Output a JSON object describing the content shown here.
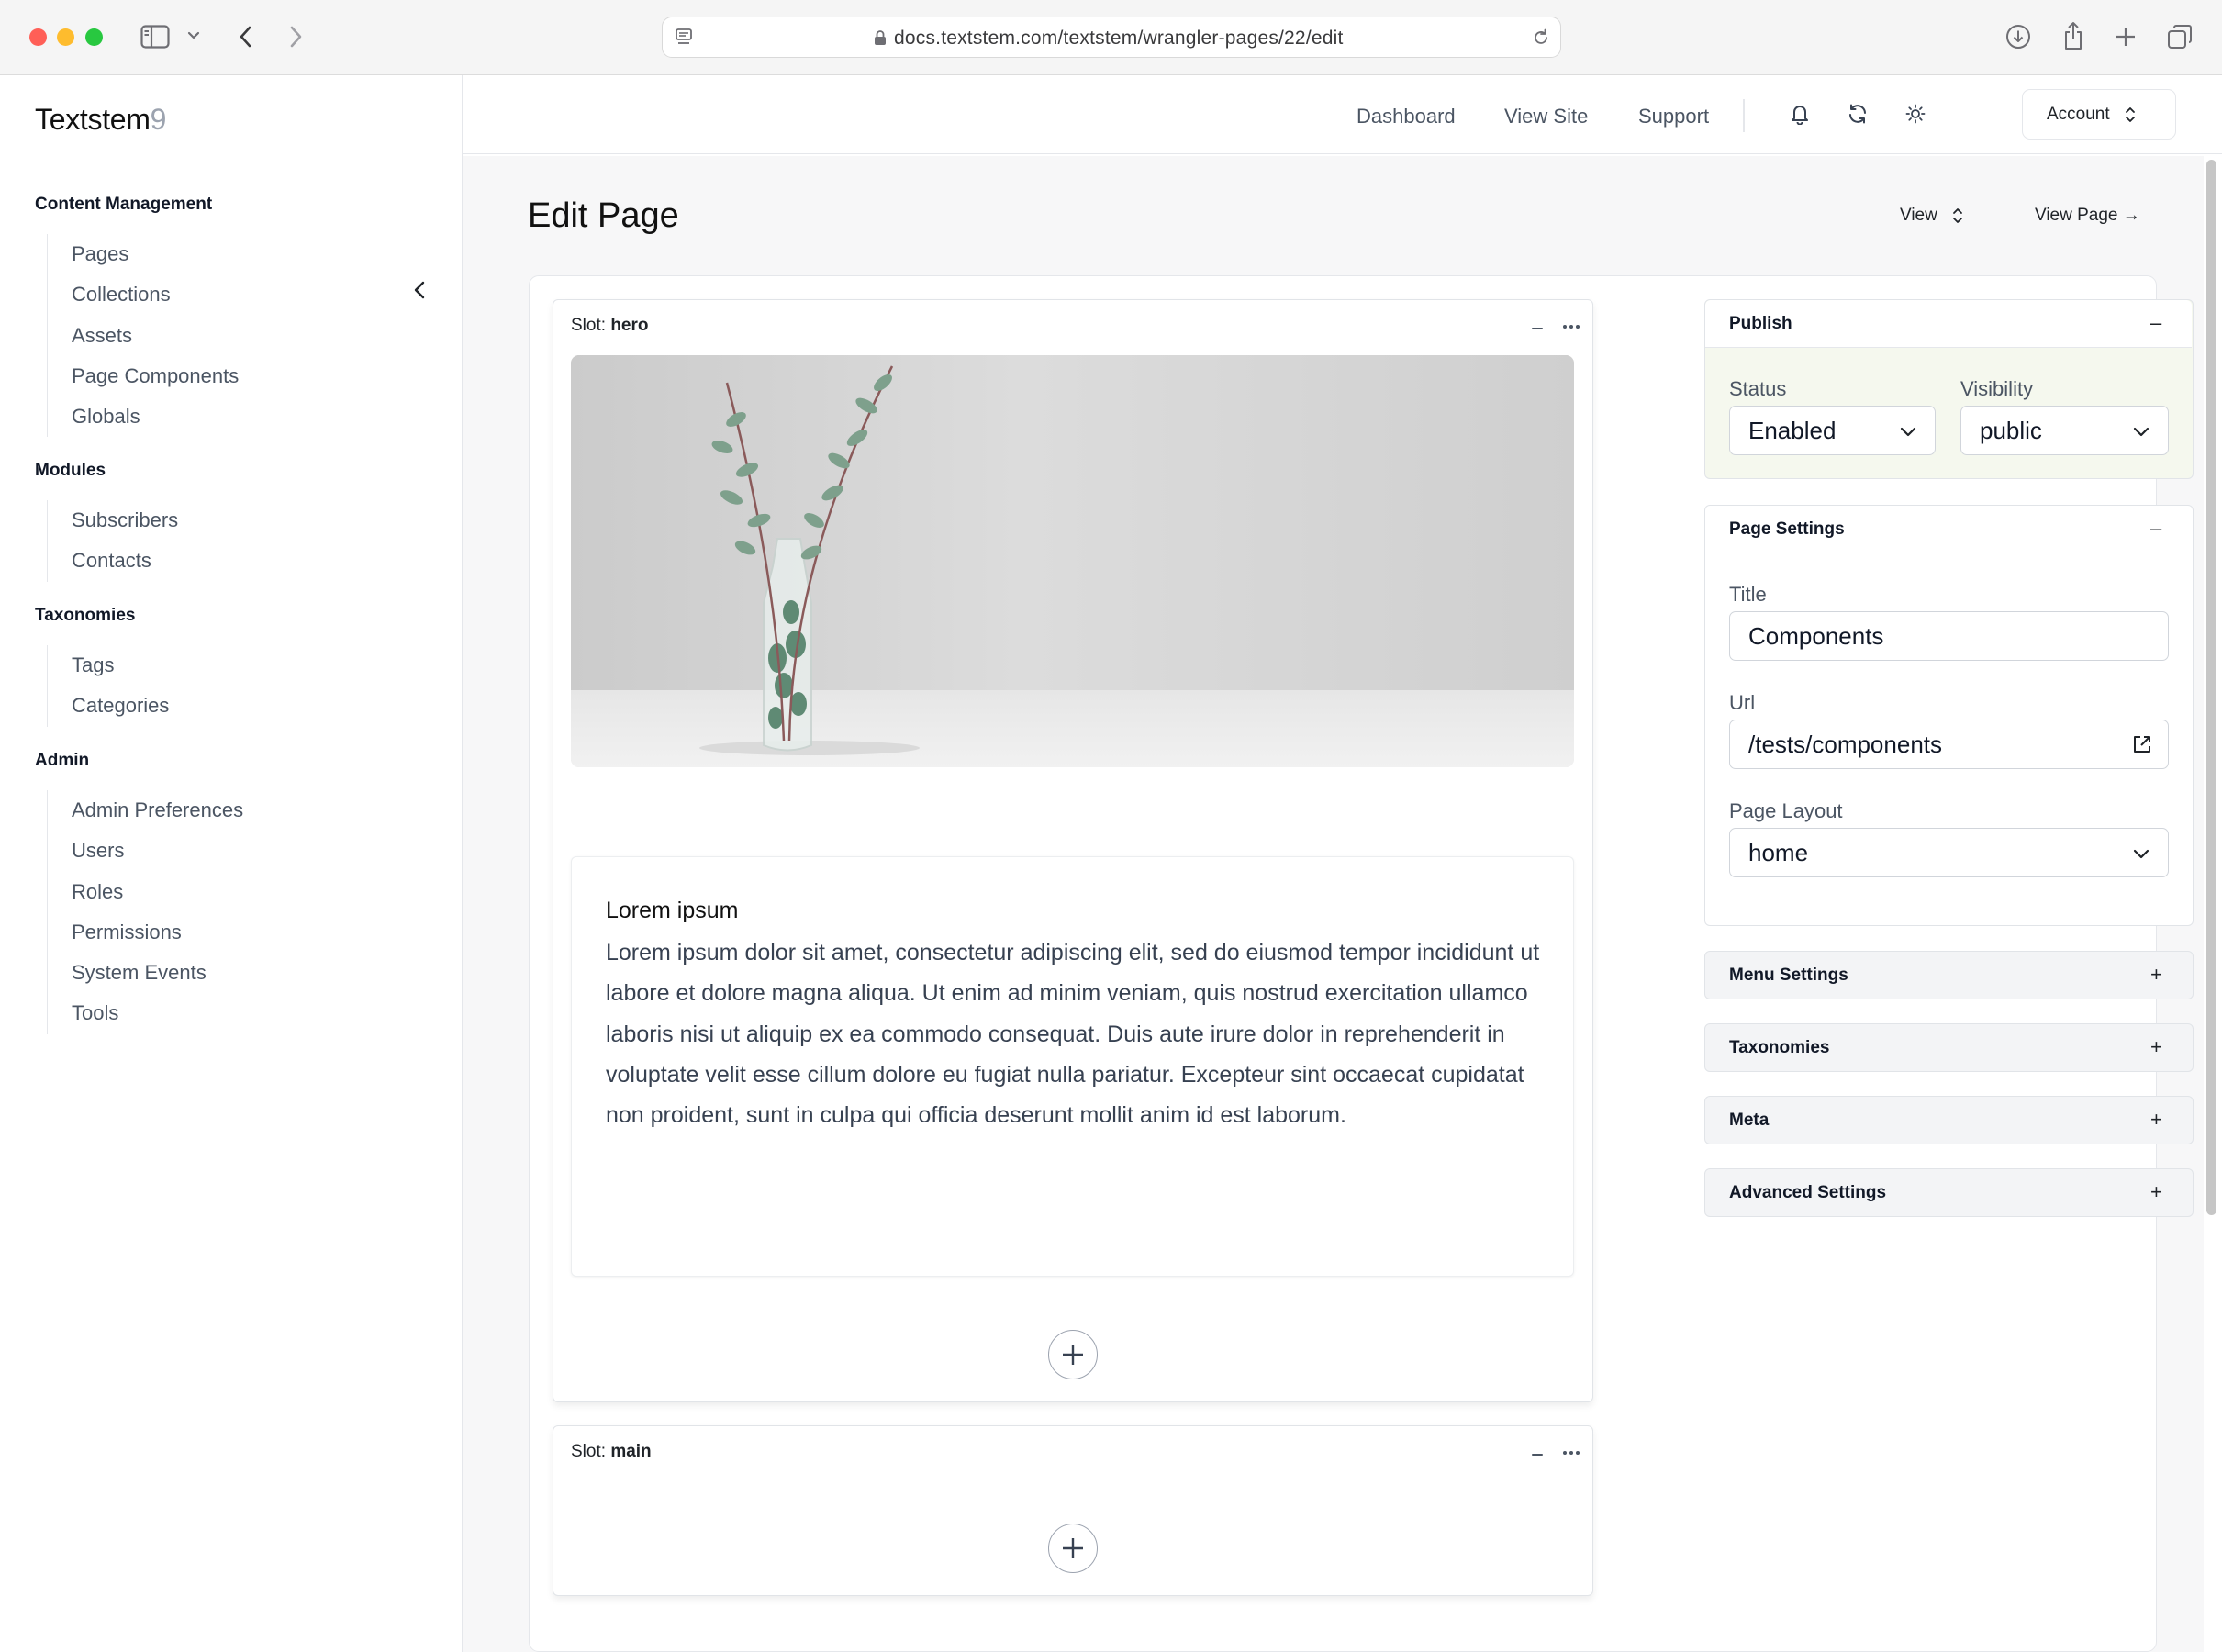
{
  "browser": {
    "url": "docs.textstem.com/textstem/wrangler-pages/22/edit"
  },
  "brand": {
    "name": "Textstem",
    "version": "9"
  },
  "sidebar": {
    "sections": [
      {
        "title": "Content Management",
        "items": [
          "Pages",
          "Collections",
          "Assets",
          "Page Components",
          "Globals"
        ]
      },
      {
        "title": "Modules",
        "items": [
          "Subscribers",
          "Contacts"
        ]
      },
      {
        "title": "Taxonomies",
        "items": [
          "Tags",
          "Categories"
        ]
      },
      {
        "title": "Admin",
        "items": [
          "Admin Preferences",
          "Users",
          "Roles",
          "Permissions",
          "System Events",
          "Tools"
        ]
      }
    ]
  },
  "topnav": {
    "links": [
      "Dashboard",
      "View Site",
      "Support"
    ],
    "account_label": "Account"
  },
  "page": {
    "title": "Edit Page",
    "view_label": "View",
    "view_page_label": "View Page →"
  },
  "slots": {
    "label_prefix": "Slot: ",
    "hero": {
      "name": "hero",
      "text_block": {
        "title": "Lorem ipsum",
        "body": "Lorem ipsum dolor sit amet, consectetur adipiscing elit, sed do eiusmod tempor incididunt ut labore et dolore magna aliqua. Ut enim ad minim veniam, quis nostrud exercitation ullamco laboris nisi ut aliquip ex ea commodo consequat. Duis aute irure dolor in reprehenderit in voluptate velit esse cillum dolore eu fugiat nulla pariatur. Excepteur sint occaecat cupidatat non proident, sunt in culpa qui officia deserunt mollit anim id est laborum."
      }
    },
    "main": {
      "name": "main"
    }
  },
  "panels": {
    "publish": {
      "title": "Publish",
      "toggle": "–",
      "status_label": "Status",
      "status_value": "Enabled",
      "visibility_label": "Visibility",
      "visibility_value": "public",
      "background": "#f5f8ee"
    },
    "page_settings": {
      "title": "Page Settings",
      "toggle": "–",
      "title_label": "Title",
      "title_value": "Components",
      "url_label": "Url",
      "url_value": "/tests/components",
      "layout_label": "Page Layout",
      "layout_value": "home"
    },
    "menu_settings": {
      "title": "Menu Settings",
      "toggle": "+"
    },
    "taxonomies": {
      "title": "Taxonomies",
      "toggle": "+"
    },
    "meta": {
      "title": "Meta",
      "toggle": "+"
    },
    "advanced_settings": {
      "title": "Advanced Settings",
      "toggle": "+"
    }
  },
  "colors": {
    "traffic_red": "#ff5f57",
    "traffic_yellow": "#febc2e",
    "traffic_green": "#28c840",
    "main_bg": "#f7f7f8",
    "publish_bg": "#f5f8ee"
  },
  "icons": [
    "sidebar-toggle-icon",
    "chevron-down-icon",
    "back-icon",
    "forward-icon",
    "site-icon",
    "lock-icon",
    "reload-icon",
    "download-icon",
    "share-icon",
    "new-tab-icon",
    "tabs-overview-icon",
    "chevron-left-icon",
    "bell-icon",
    "refresh-icon",
    "sun-icon",
    "sort-icon",
    "arrow-right-icon",
    "minimize-icon",
    "more-icon",
    "plus-icon",
    "external-link-icon"
  ]
}
